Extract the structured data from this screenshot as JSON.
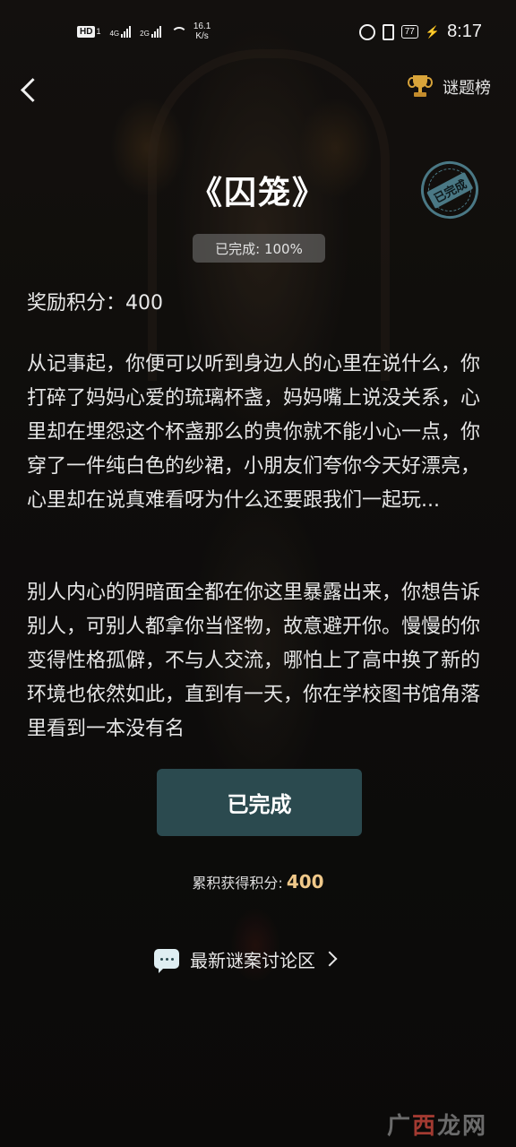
{
  "status_bar": {
    "hd": "HD",
    "sim1": "1",
    "net1": "4G",
    "net2": "2G",
    "speed_value": "16.1",
    "speed_unit": "K/s",
    "battery": "77",
    "time": "8:17"
  },
  "nav": {
    "rank_label": "谜题榜"
  },
  "puzzle": {
    "title": "《囚笼》",
    "stamp": "已完成",
    "progress_label": "已完成: 100%",
    "reward": "奖励积分：400",
    "paragraph1": "从记事起，你便可以听到身边人的心里在说什么，你打碎了妈妈心爱的琉璃杯盏，妈妈嘴上说没关系，心里却在埋怨这个杯盏那么的贵你就不能小心一点，你穿了一件纯白色的纱裙，小朋友们夸你今天好漂亮，心里却在说真难看呀为什么还要跟我们一起玩...",
    "paragraph2": "别人内心的阴暗面全都在你这里暴露出来，你想告诉别人，可别人都拿你当怪物，故意避开你。慢慢的你变得性格孤僻，不与人交流，哪怕上了高中换了新的环境也依然如此，直到有一天，你在学校图书馆角落里看到一本没有名"
  },
  "actions": {
    "done_button": "已完成",
    "total_label": "累积获得积分:",
    "total_value": "400",
    "discuss_label": "最新谜案讨论区"
  },
  "watermark": {
    "part1": "广",
    "part2": "西",
    "part3": "龙网"
  },
  "colors": {
    "button_bg": "#2b4a4f",
    "accent_score": "#f0c98a",
    "trophy": "#d9a43a",
    "stamp": "#4a7885"
  }
}
